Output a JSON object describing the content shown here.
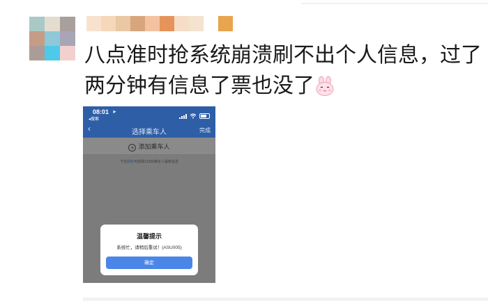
{
  "post": {
    "text": "八点准时抢系统崩溃刷不出个人信息，过了两分钟有信息了票也没了",
    "emoji": "rabbit-face"
  },
  "avatar_colors": [
    "#a9c9c6",
    "#e3ddd0",
    "#a9a09e",
    "#c59c86",
    "#8fc8d8",
    "#a7a5b6",
    "#ac9c97",
    "#4ec9e9",
    "#f3d0cd"
  ],
  "name_colors": [
    "#f8e2cf",
    "#f6d7b9",
    "#e9c8a3",
    "#d9a57c",
    "#f4c2a1",
    "#e6945b",
    "#f5ddc8",
    "#f4e3cf",
    "gap",
    "#e9a44f"
  ],
  "phone": {
    "time": "08:01",
    "back_app": "◂搜索",
    "nav": {
      "title": "选择乘车人",
      "done": "完成"
    },
    "add_passenger": "添加乘车人",
    "hint": {
      "prefix": "下拉",
      "link": "刷新",
      "suffix": "可获取12306乘车人最新信息"
    },
    "dialog": {
      "title": "温馨提示",
      "message": "系统忙，请稍后重试！(ASU005)",
      "confirm": "确定"
    }
  }
}
